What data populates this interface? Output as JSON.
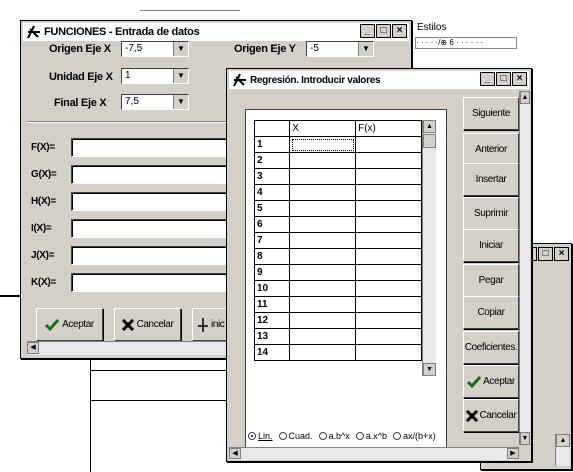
{
  "bg": {
    "estilos_label": "Estilos"
  },
  "funciones": {
    "title": "FUNCIONES - Entrada de datos",
    "origen_x_label": "Origen Eje X",
    "origen_x_value": "-7,5",
    "origen_y_label": "Origen Eje Y",
    "origen_y_value": "-5",
    "unidad_x_label": "Unidad Eje X",
    "unidad_x_value": "1",
    "final_x_label": "Final Eje X",
    "final_x_value": "7,5",
    "functions": [
      {
        "label": "F(X)="
      },
      {
        "label": "G(X)="
      },
      {
        "label": "H(X)="
      },
      {
        "label": "I(X)="
      },
      {
        "label": "J(X)="
      },
      {
        "label": "K(X)="
      }
    ],
    "aceptar_label": "Aceptar",
    "cancelar_label": "Cancelar",
    "third_button_label": "inic"
  },
  "regresion": {
    "title": "Regresión. Introducir valores",
    "col_x": "X",
    "col_f": "F(x)",
    "rows": [
      "1",
      "2",
      "3",
      "4",
      "5",
      "6",
      "7",
      "8",
      "9",
      "10",
      "11",
      "12",
      "13",
      "14"
    ],
    "buttons": {
      "siguiente": "Siguiente",
      "anterior": "Anterior",
      "insertar": "Insertar",
      "suprimir": "Suprimir",
      "iniciar": "Iniciar",
      "pegar": "Pegar",
      "copiar": "Copiar",
      "coeficientes": "Coeficientes.",
      "aceptar": "Aceptar",
      "cancelar": "Cancelar"
    },
    "radios": [
      "Lin.",
      "Cuad.",
      "a.b^x",
      "a.x^b",
      "ax/(b+x)"
    ],
    "selected_radio": "Lin."
  },
  "colors": {
    "window_face": "#d4d0c8",
    "accept_check": "#1a6e1a",
    "cancel_x": "#000000"
  }
}
